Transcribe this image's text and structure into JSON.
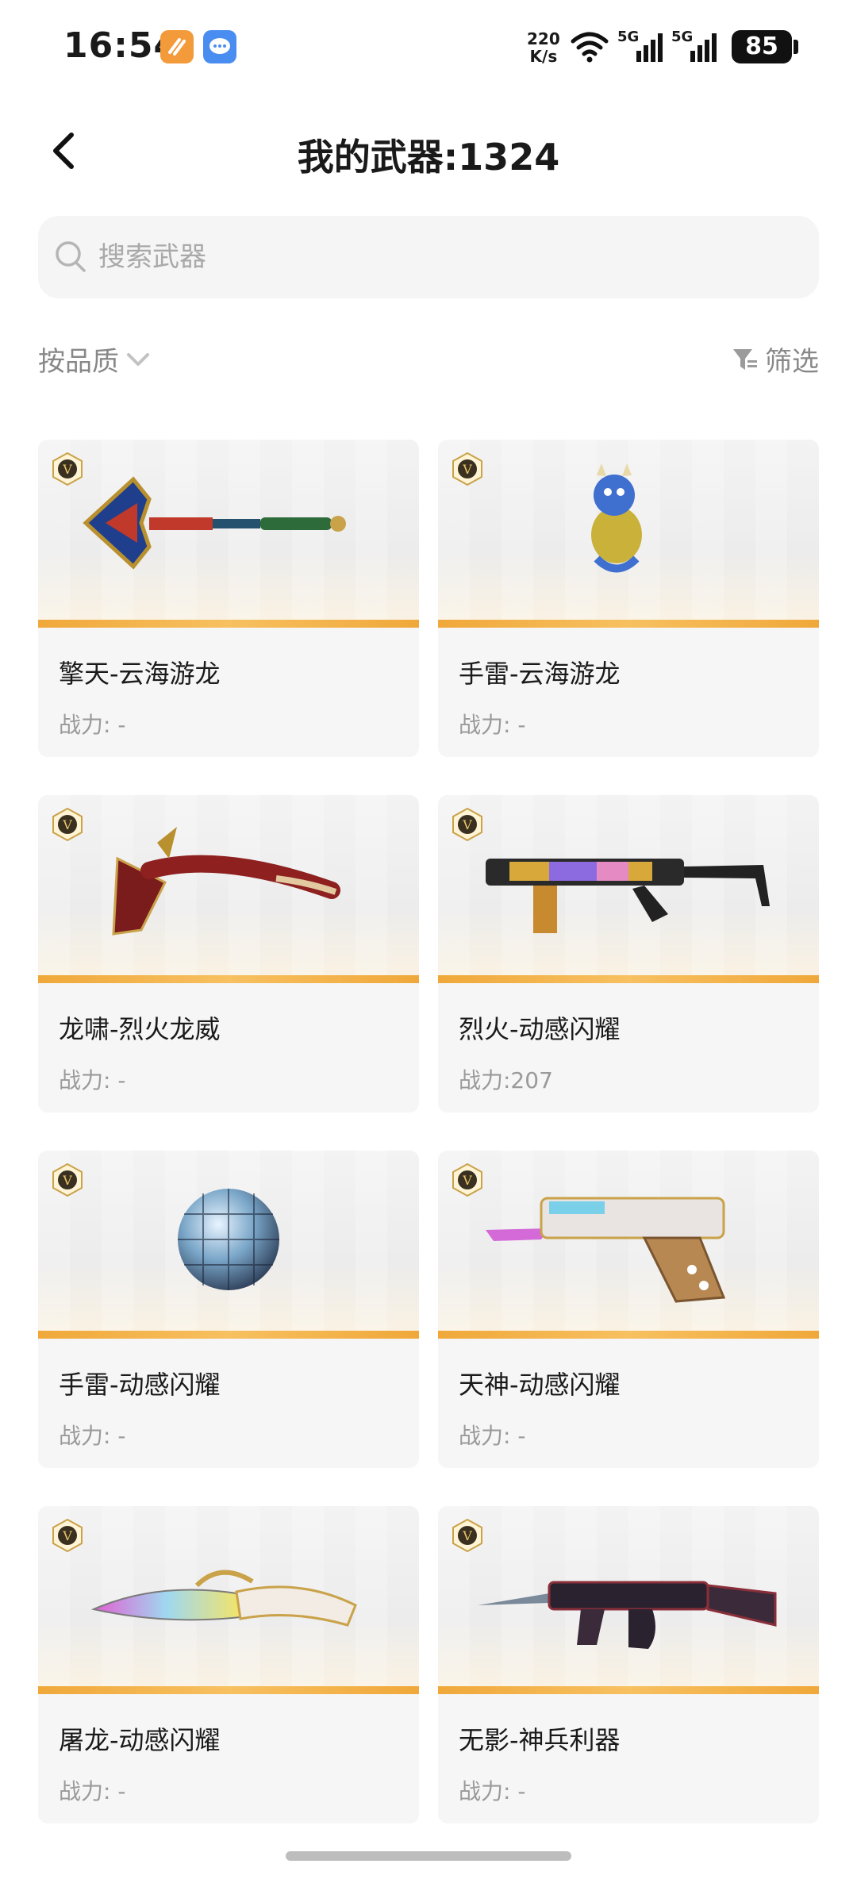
{
  "status_bar": {
    "time": "16:54",
    "net_speed_value": "220",
    "net_speed_unit": "K/s",
    "signal_1_label": "5G",
    "signal_2_label": "5G",
    "battery": "85",
    "icons": [
      "orange-app-icon",
      "message-app-icon",
      "wifi-icon",
      "signal-icon",
      "battery-icon"
    ]
  },
  "header": {
    "title": "我的武器:1324",
    "back_icon": "chevron-left-icon"
  },
  "search": {
    "placeholder": "搜索武器",
    "icon": "search-icon"
  },
  "filters": {
    "sort_label": "按品质",
    "filter_label": "筛选"
  },
  "colors": {
    "accent_bar": "#f0a83a",
    "badge_gold": "#c9a24a",
    "card_bg": "#f6f6f6",
    "muted_text": "#9a9a9a"
  },
  "weapons": [
    {
      "name": "擎天-云海游龙",
      "power": "战力: -",
      "badge": "V",
      "art": "dragon-shovel-icon"
    },
    {
      "name": "手雷-云海游龙",
      "power": "战力: -",
      "badge": "V",
      "art": "dragon-grenade-icon"
    },
    {
      "name": "龙啸-烈火龙威",
      "power": "战力: -",
      "badge": "V",
      "art": "dragon-axe-icon"
    },
    {
      "name": "烈火-动感闪耀",
      "power": "战力:207",
      "badge": "V",
      "art": "submachine-gun-icon"
    },
    {
      "name": "手雷-动感闪耀",
      "power": "战力: -",
      "badge": "V",
      "art": "disco-ball-grenade-icon"
    },
    {
      "name": "天神-动感闪耀",
      "power": "战力: -",
      "badge": "V",
      "art": "pistol-icon"
    },
    {
      "name": "屠龙-动感闪耀",
      "power": "战力: -",
      "badge": "V",
      "art": "knife-icon"
    },
    {
      "name": "无影-神兵利器",
      "power": "战力: -",
      "badge": "V",
      "art": "rifle-icon"
    }
  ]
}
